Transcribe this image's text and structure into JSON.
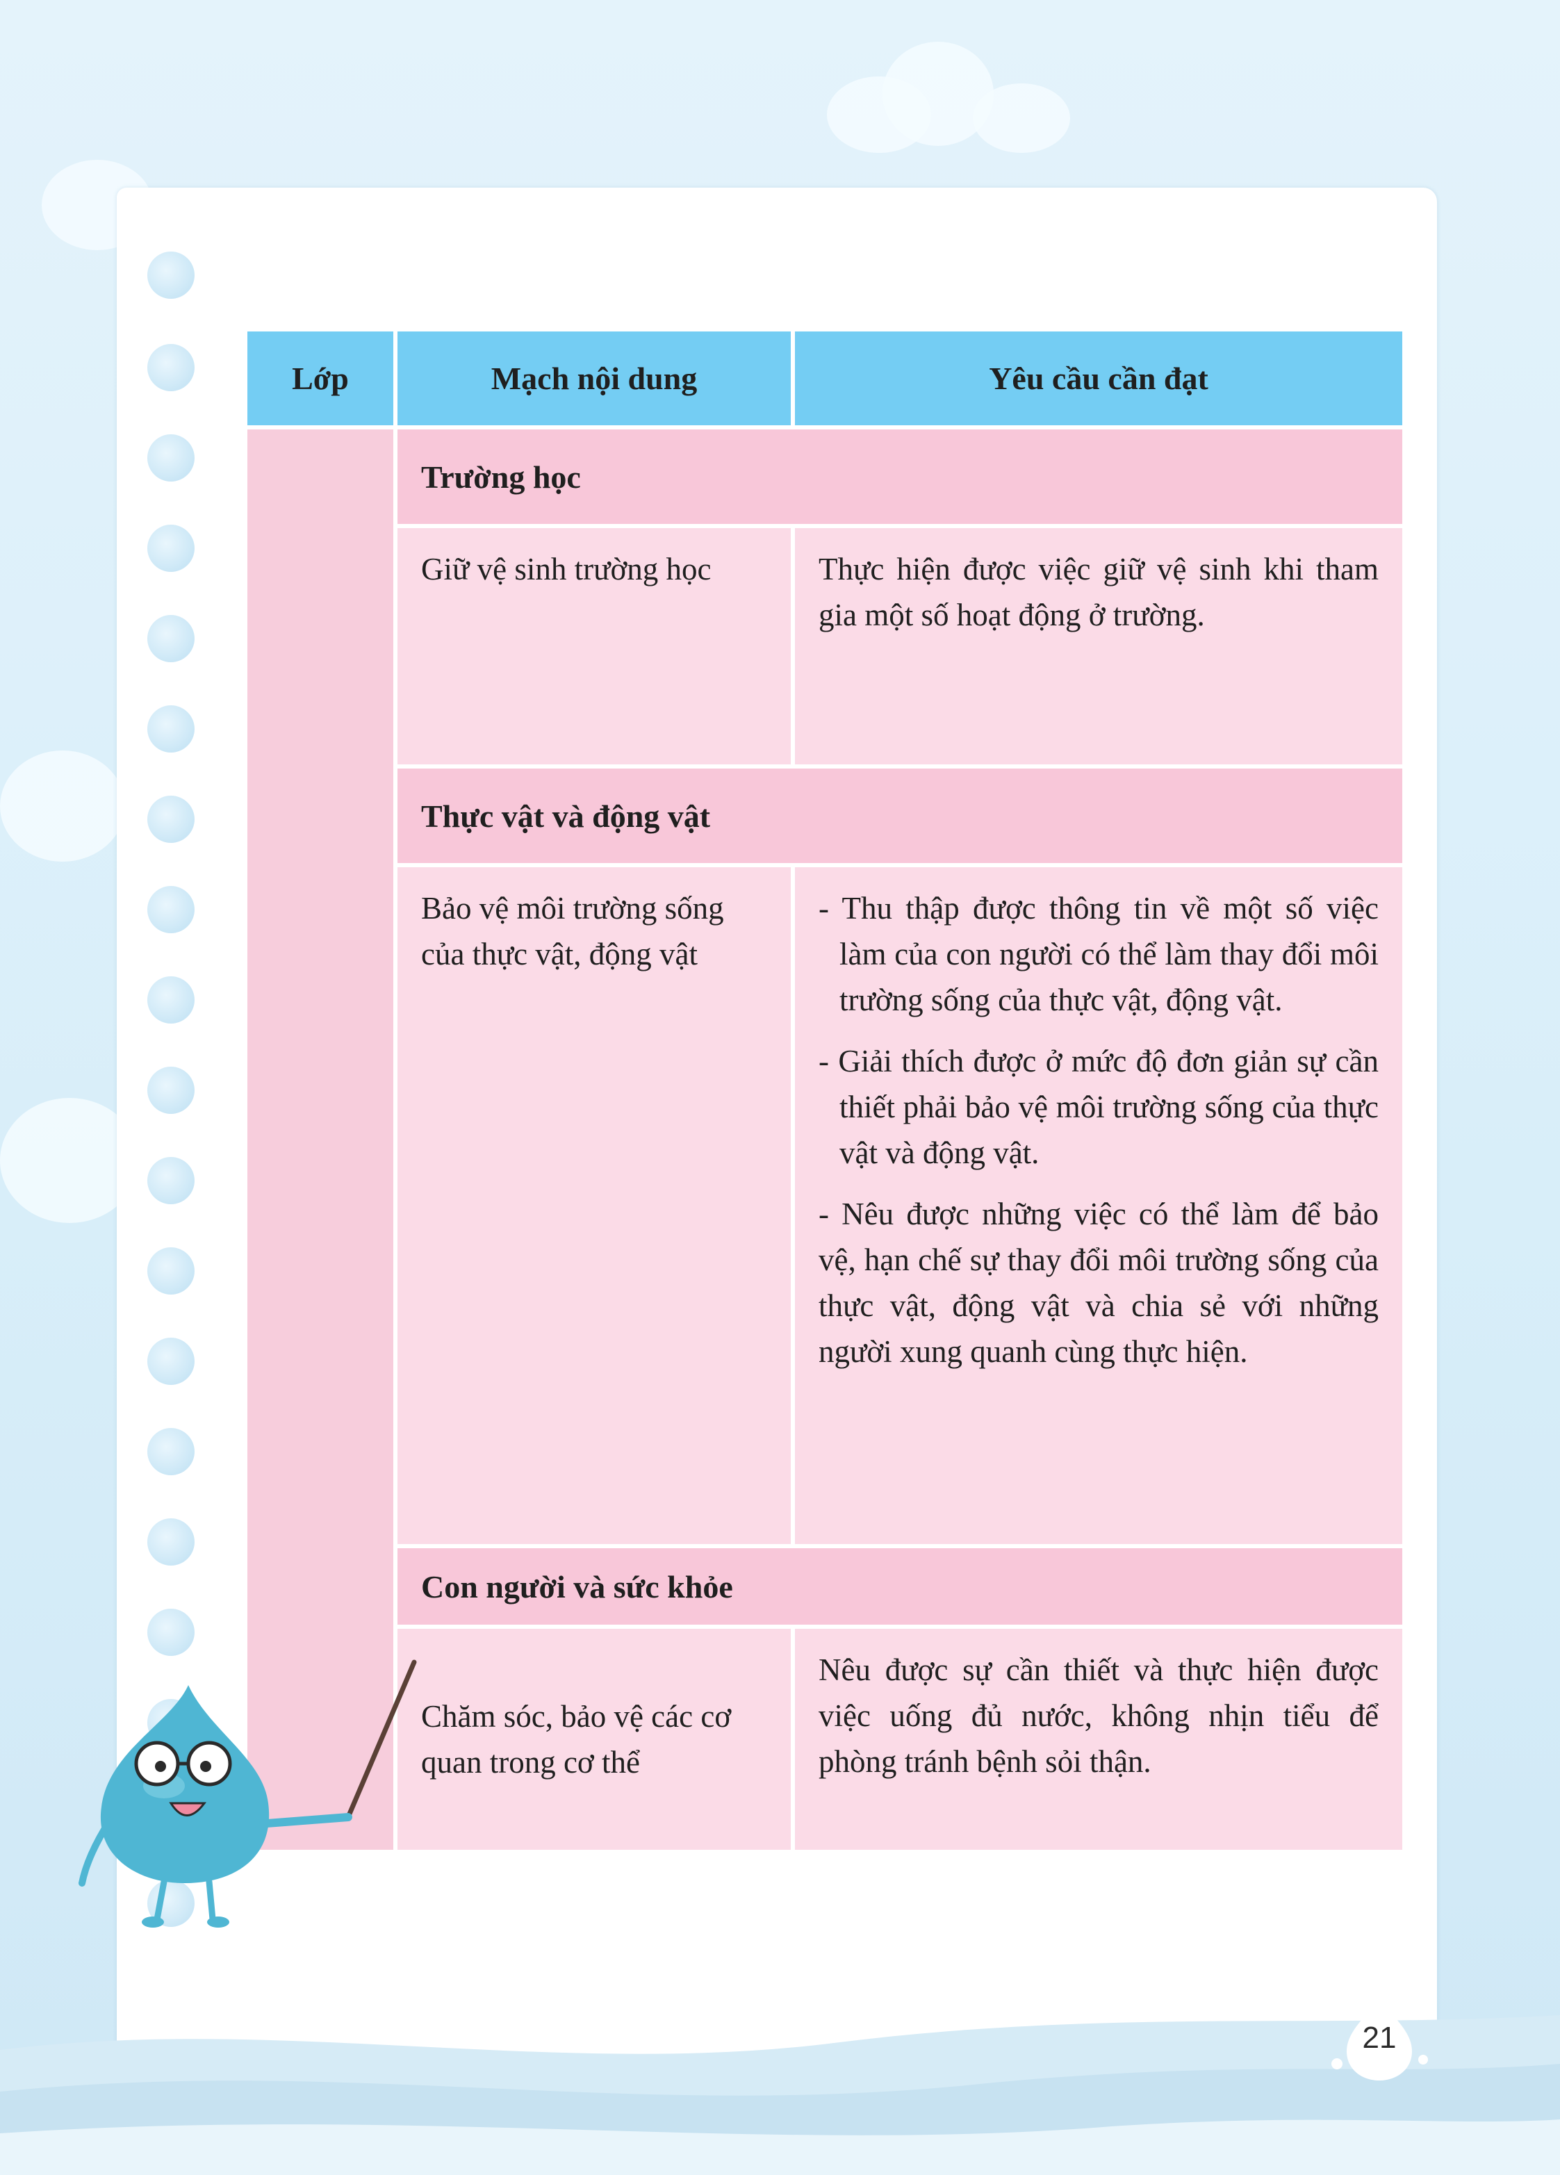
{
  "table": {
    "headers": [
      "Lớp",
      "Mạch nội dung",
      "Yêu cầu cần đạt"
    ],
    "grade_value": "",
    "sections": [
      {
        "title": "Trường học",
        "topic": "Giữ vệ sinh trường học",
        "requirements": [
          "Thực hiện được việc giữ vệ sinh khi tham gia một số hoạt động ở trường."
        ]
      },
      {
        "title": "Thực vật và động vật",
        "topic": "Bảo vệ môi trường sống của thực vật, động vật",
        "requirements": [
          "- Thu thập được thông tin về một số việc làm của con người có thể làm thay đổi môi trường sống của thực vật, động vật.",
          "- Giải thích được ở mức độ đơn giản sự cần thiết phải bảo vệ môi trường sống của thực vật và động vật.",
          "- Nêu được những việc có thể làm để bảo vệ, hạn chế sự thay đổi môi trường sống của thực vật, động vật và chia sẻ với những người xung quanh cùng thực hiện."
        ]
      },
      {
        "title": "Con người và sức khỏe",
        "topic": "Chăm sóc, bảo vệ các cơ quan trong cơ thể",
        "requirements": [
          "Nêu được sự cần thiết và thực hiện được việc uống đủ nước, không nhịn tiểu để phòng tránh bệnh sỏi thận."
        ]
      }
    ]
  },
  "page_number": "21",
  "colors": {
    "header_bg": "#74cdf3",
    "section_bg": "#f8c7d9",
    "cell_bg": "#fbdbe7",
    "background": "#e4f3fb",
    "mascot": "#4fb6d3"
  }
}
